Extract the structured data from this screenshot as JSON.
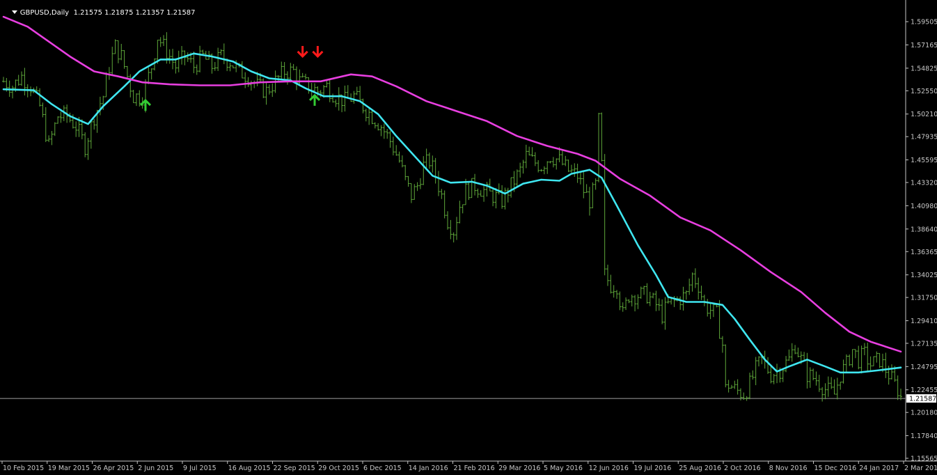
{
  "header": {
    "symbol": "GBPUSD,Daily",
    "ohlc": "1.21575 1.21875 1.21357 1.21587",
    "menu_icon": "dropdown-triangle-icon"
  },
  "colors": {
    "background": "#000000",
    "candles": "#5fa83a",
    "fast_ma": "#3fe6f0",
    "slow_ma": "#e83fe0",
    "arrow_up": "#33cc33",
    "arrow_down": "#ff1a1a",
    "axis": "#c8c8c8",
    "price_line": "#a0a0a0"
  },
  "chart_data": {
    "type": "line",
    "ylim": [
      1.15565,
      1.60705
    ],
    "y_ticks": [
      "1.59505",
      "1.57165",
      "1.54825",
      "1.52550",
      "1.50210",
      "1.47935",
      "1.45595",
      "1.43320",
      "1.40980",
      "1.38640",
      "1.36365",
      "1.34025",
      "1.31750",
      "1.29410",
      "1.27135",
      "1.24795",
      "1.22455",
      "1.20180",
      "1.17840",
      "1.15565"
    ],
    "x_labels": [
      "10 Feb 2015",
      "19 Mar 2015",
      "26 Apr 2015",
      "2 Jun 2015",
      "9 Jul 2015",
      "16 Aug 2015",
      "22 Sep 2015",
      "29 Oct 2015",
      "6 Dec 2015",
      "14 Jan 2016",
      "21 Feb 2016",
      "29 Mar 2016",
      "5 May 2016",
      "12 Jun 2016",
      "19 Jul 2016",
      "25 Aug 2016",
      "2 Oct 2016",
      "8 Nov 2016",
      "15 Dec 2016",
      "24 Jan 2017",
      "2 Mar 2017"
    ],
    "current_price": "1.21587",
    "price_series": [
      [
        0,
        1.535
      ],
      [
        3,
        1.53
      ],
      [
        6,
        1.54
      ],
      [
        9,
        1.53
      ],
      [
        12,
        1.51
      ],
      [
        15,
        1.47
      ],
      [
        18,
        1.5
      ],
      [
        21,
        1.5
      ],
      [
        24,
        1.49
      ],
      [
        27,
        1.47
      ],
      [
        30,
        1.5
      ],
      [
        33,
        1.52
      ],
      [
        35,
        1.55
      ],
      [
        37,
        1.57
      ],
      [
        39,
        1.56
      ],
      [
        41,
        1.54
      ],
      [
        43,
        1.52
      ],
      [
        46,
        1.52
      ],
      [
        49,
        1.55
      ],
      [
        51,
        1.58
      ],
      [
        53,
        1.57
      ],
      [
        55,
        1.56
      ],
      [
        57,
        1.55
      ],
      [
        60,
        1.56
      ],
      [
        63,
        1.55
      ],
      [
        66,
        1.56
      ],
      [
        69,
        1.55
      ],
      [
        72,
        1.56
      ],
      [
        75,
        1.555
      ],
      [
        78,
        1.545
      ],
      [
        81,
        1.54
      ],
      [
        84,
        1.53
      ],
      [
        87,
        1.525
      ],
      [
        90,
        1.535
      ],
      [
        93,
        1.545
      ],
      [
        96,
        1.545
      ],
      [
        98,
        1.535
      ],
      [
        101,
        1.53
      ],
      [
        104,
        1.525
      ],
      [
        107,
        1.53
      ],
      [
        110,
        1.52
      ],
      [
        113,
        1.515
      ],
      [
        116,
        1.52
      ],
      [
        119,
        1.51
      ],
      [
        122,
        1.5
      ],
      [
        125,
        1.49
      ],
      [
        128,
        1.475
      ],
      [
        131,
        1.455
      ],
      [
        133,
        1.435
      ],
      [
        135,
        1.42
      ],
      [
        137,
        1.43
      ],
      [
        139,
        1.45
      ],
      [
        141,
        1.455
      ],
      [
        143,
        1.44
      ],
      [
        145,
        1.42
      ],
      [
        147,
        1.395
      ],
      [
        149,
        1.385
      ],
      [
        151,
        1.41
      ],
      [
        153,
        1.425
      ],
      [
        156,
        1.43
      ],
      [
        159,
        1.425
      ],
      [
        162,
        1.42
      ],
      [
        165,
        1.415
      ],
      [
        168,
        1.43
      ],
      [
        171,
        1.445
      ],
      [
        173,
        1.46
      ],
      [
        175,
        1.455
      ],
      [
        178,
        1.45
      ],
      [
        181,
        1.46
      ],
      [
        184,
        1.455
      ],
      [
        187,
        1.445
      ],
      [
        190,
        1.44
      ],
      [
        192,
        1.425
      ],
      [
        194,
        1.415
      ],
      [
        196,
        1.43
      ],
      [
        197,
        1.495
      ],
      [
        198,
        1.45
      ],
      [
        199,
        1.34
      ],
      [
        201,
        1.33
      ],
      [
        203,
        1.33
      ],
      [
        205,
        1.3
      ],
      [
        207,
        1.32
      ],
      [
        210,
        1.32
      ],
      [
        213,
        1.32
      ],
      [
        216,
        1.31
      ],
      [
        218,
        1.3
      ],
      [
        220,
        1.31
      ],
      [
        223,
        1.315
      ],
      [
        226,
        1.32
      ],
      [
        228,
        1.34
      ],
      [
        230,
        1.33
      ],
      [
        232,
        1.31
      ],
      [
        234,
        1.305
      ],
      [
        236,
        1.3
      ],
      [
        238,
        1.27
      ],
      [
        239,
        1.225
      ],
      [
        240,
        1.23
      ],
      [
        242,
        1.225
      ],
      [
        245,
        1.22
      ],
      [
        247,
        1.23
      ],
      [
        249,
        1.245
      ],
      [
        251,
        1.255
      ],
      [
        254,
        1.24
      ],
      [
        257,
        1.245
      ],
      [
        260,
        1.255
      ],
      [
        262,
        1.27
      ],
      [
        264,
        1.255
      ],
      [
        266,
        1.24
      ],
      [
        269,
        1.235
      ],
      [
        272,
        1.225
      ],
      [
        275,
        1.22
      ],
      [
        277,
        1.24
      ],
      [
        279,
        1.25
      ],
      [
        281,
        1.265
      ],
      [
        283,
        1.255
      ],
      [
        285,
        1.26
      ],
      [
        287,
        1.25
      ],
      [
        290,
        1.255
      ],
      [
        293,
        1.24
      ],
      [
        296,
        1.225
      ],
      [
        297,
        1.217
      ]
    ],
    "series": [
      {
        "values": [
          [
            0,
            1.527
          ],
          [
            10,
            1.526
          ],
          [
            16,
            1.512
          ],
          [
            22,
            1.5
          ],
          [
            28,
            1.492
          ],
          [
            33,
            1.51
          ],
          [
            40,
            1.53
          ],
          [
            45,
            1.545
          ],
          [
            52,
            1.557
          ],
          [
            57,
            1.557
          ],
          [
            63,
            1.563
          ],
          [
            69,
            1.56
          ],
          [
            76,
            1.555
          ],
          [
            82,
            1.545
          ],
          [
            88,
            1.538
          ],
          [
            95,
            1.536
          ],
          [
            100,
            1.528
          ],
          [
            106,
            1.52
          ],
          [
            112,
            1.52
          ],
          [
            118,
            1.515
          ],
          [
            124,
            1.502
          ],
          [
            130,
            1.48
          ],
          [
            136,
            1.46
          ],
          [
            142,
            1.44
          ],
          [
            148,
            1.433
          ],
          [
            155,
            1.434
          ],
          [
            160,
            1.43
          ],
          [
            166,
            1.422
          ],
          [
            172,
            1.432
          ],
          [
            178,
            1.436
          ],
          [
            184,
            1.435
          ],
          [
            188,
            1.442
          ],
          [
            194,
            1.446
          ],
          [
            198,
            1.438
          ],
          [
            203,
            1.41
          ],
          [
            210,
            1.37
          ],
          [
            216,
            1.34
          ],
          [
            220,
            1.318
          ],
          [
            226,
            1.313
          ],
          [
            232,
            1.313
          ],
          [
            238,
            1.31
          ],
          [
            242,
            1.296
          ],
          [
            247,
            1.275
          ],
          [
            252,
            1.255
          ],
          [
            256,
            1.243
          ],
          [
            260,
            1.248
          ],
          [
            266,
            1.255
          ],
          [
            272,
            1.248
          ],
          [
            277,
            1.242
          ],
          [
            283,
            1.242
          ],
          [
            289,
            1.244
          ],
          [
            297,
            1.247
          ]
        ]
      },
      {
        "values": [
          [
            0,
            1.6
          ],
          [
            8,
            1.59
          ],
          [
            15,
            1.575
          ],
          [
            22,
            1.56
          ],
          [
            30,
            1.545
          ],
          [
            38,
            1.54
          ],
          [
            46,
            1.534
          ],
          [
            55,
            1.532
          ],
          [
            65,
            1.531
          ],
          [
            75,
            1.531
          ],
          [
            85,
            1.534
          ],
          [
            95,
            1.535
          ],
          [
            105,
            1.535
          ],
          [
            115,
            1.542
          ],
          [
            122,
            1.54
          ],
          [
            130,
            1.53
          ],
          [
            140,
            1.515
          ],
          [
            150,
            1.505
          ],
          [
            160,
            1.495
          ],
          [
            170,
            1.48
          ],
          [
            180,
            1.47
          ],
          [
            190,
            1.462
          ],
          [
            196,
            1.455
          ],
          [
            204,
            1.437
          ],
          [
            214,
            1.42
          ],
          [
            224,
            1.398
          ],
          [
            234,
            1.385
          ],
          [
            244,
            1.365
          ],
          [
            254,
            1.343
          ],
          [
            264,
            1.323
          ],
          [
            272,
            1.302
          ],
          [
            280,
            1.283
          ],
          [
            287,
            1.273
          ],
          [
            297,
            1.263
          ]
        ]
      }
    ],
    "arrows": [
      {
        "dir": "up",
        "x": 47,
        "price": 1.511
      },
      {
        "dir": "down",
        "x": 99,
        "price": 1.565
      },
      {
        "dir": "down",
        "x": 104,
        "price": 1.565
      },
      {
        "dir": "up",
        "x": 103,
        "price": 1.516
      }
    ]
  }
}
